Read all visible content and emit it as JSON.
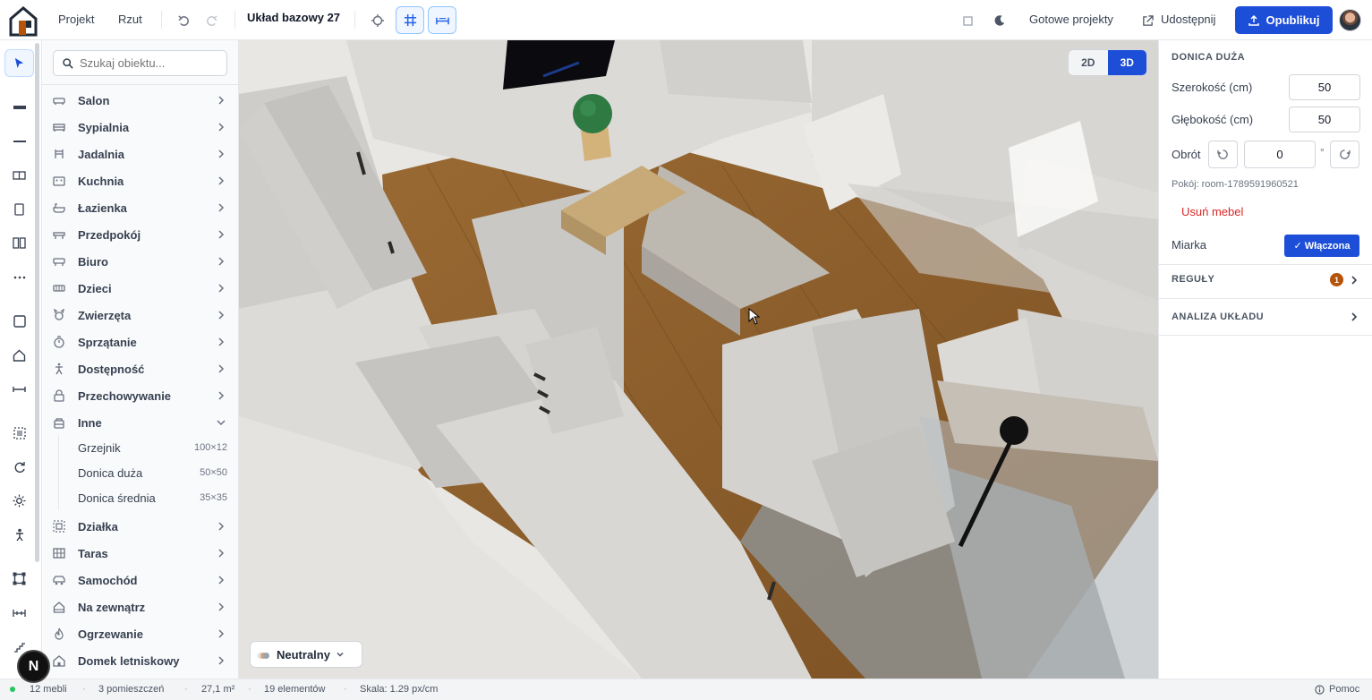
{
  "topbar": {
    "menu_project": "Projekt",
    "menu_plan": "Rzut",
    "project_title": "Układ bazowy 27",
    "ready_projects": "Gotowe projekty",
    "share": "Udostępnij",
    "publish": "Opublikuj"
  },
  "search": {
    "placeholder": "Szukaj obiektu..."
  },
  "categories": [
    {
      "label": "Salon",
      "icon": "sofa-icon"
    },
    {
      "label": "Sypialnia",
      "icon": "bed-icon"
    },
    {
      "label": "Jadalnia",
      "icon": "chair-icon"
    },
    {
      "label": "Kuchnia",
      "icon": "stove-icon"
    },
    {
      "label": "Łazienka",
      "icon": "bath-icon"
    },
    {
      "label": "Przedpokój",
      "icon": "bench-icon"
    },
    {
      "label": "Biuro",
      "icon": "desk-icon"
    },
    {
      "label": "Dzieci",
      "icon": "crib-icon"
    },
    {
      "label": "Zwierzęta",
      "icon": "pet-icon"
    },
    {
      "label": "Sprzątanie",
      "icon": "timer-icon"
    },
    {
      "label": "Dostępność",
      "icon": "accessibility-icon"
    },
    {
      "label": "Przechowywanie",
      "icon": "lock-icon"
    },
    {
      "label": "Inne",
      "icon": "box-icon"
    },
    {
      "label": "Działka",
      "icon": "plot-icon"
    },
    {
      "label": "Taras",
      "icon": "grid-icon"
    },
    {
      "label": "Samochód",
      "icon": "car-icon"
    },
    {
      "label": "Na zewnątrz",
      "icon": "home-icon"
    },
    {
      "label": "Ogrzewanie",
      "icon": "flame-icon"
    },
    {
      "label": "Domek letniskowy",
      "icon": "cabin-icon"
    }
  ],
  "inne_items": [
    {
      "label": "Grzejnik",
      "dim": "100×12"
    },
    {
      "label": "Donica duża",
      "dim": "50×50"
    },
    {
      "label": "Donica średnia",
      "dim": "35×35"
    }
  ],
  "view_toggle": {
    "two_d": "2D",
    "three_d": "3D",
    "active": "3D"
  },
  "palette": {
    "label": "Neutralny",
    "colors": [
      "#e5e7eb",
      "#d4a373",
      "#9ca3af"
    ]
  },
  "props": {
    "title": "DONICA DUŻA",
    "width_label": "Szerokość (cm)",
    "width_value": "50",
    "depth_label": "Głębokość (cm)",
    "depth_value": "50",
    "rotation_label": "Obrót",
    "rotation_value": "0",
    "rotation_unit": "°",
    "room": "Pokój: room-1789591960521",
    "delete": "Usuń mebel",
    "ruler_label": "Miarka",
    "ruler_state": "✓ Włączona",
    "rules": "REGUŁY",
    "rules_count": "1",
    "analysis": "ANALIZA UKŁADU"
  },
  "status": {
    "furniture": "12 mebli",
    "rooms": "3 pomieszczeń",
    "area": "27,1 m²",
    "elements": "19 elementów",
    "scale": "Skala: 1.29 px/cm",
    "help": "Pomoc"
  },
  "colors": {
    "accent": "#1d4ed8",
    "danger": "#dc2626",
    "floor": "#8b5a2b",
    "wall": "#d8d6d3"
  }
}
